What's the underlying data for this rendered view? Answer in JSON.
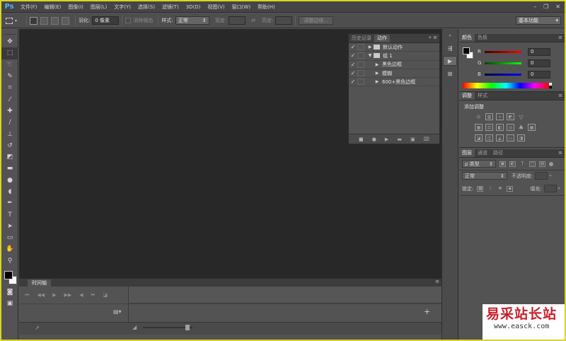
{
  "app": {
    "logo": "Ps"
  },
  "menu": [
    "文件(F)",
    "编辑(E)",
    "图像(I)",
    "图层(L)",
    "文字(Y)",
    "选择(S)",
    "滤镜(T)",
    "3D(D)",
    "视图(V)",
    "窗口(W)",
    "帮助(H)"
  ],
  "window_controls": {
    "minimize": "–",
    "restore": "❐",
    "close": "✕"
  },
  "options": {
    "feather_label": "羽化:",
    "feather_value": "0 像素",
    "antialias_label": "消除锯齿",
    "style_label": "样式:",
    "style_value": "正常",
    "width_label": "宽度:",
    "height_label": "高度:",
    "refine_edge": "调整边缘...",
    "workspace": "基本功能"
  },
  "actions_panel": {
    "tabs": [
      "历史记录",
      "动作"
    ],
    "rows": [
      {
        "label": "默认动作",
        "type": "set",
        "expanded": false
      },
      {
        "label": "组 1",
        "type": "set",
        "expanded": true
      },
      {
        "label": "黑色边框",
        "type": "action"
      },
      {
        "label": "模糊",
        "type": "action"
      },
      {
        "label": "600+黑色边框",
        "type": "action"
      }
    ]
  },
  "timeline": {
    "tab": "时间轴"
  },
  "color_panel": {
    "tabs": [
      "颜色",
      "色板"
    ],
    "sliders": [
      {
        "letter": "R",
        "value": "0",
        "color": "#d03030"
      },
      {
        "letter": "G",
        "value": "0",
        "color": "#30b030"
      },
      {
        "letter": "B",
        "value": "0",
        "color": "#3050d0"
      }
    ]
  },
  "adjustments_panel": {
    "tabs": [
      "调整",
      "样式"
    ],
    "title": "添加调整",
    "icons": [
      "brightness-icon",
      "levels-icon",
      "curves-icon",
      "exposure-icon",
      "vibrance-icon",
      "hsl-icon",
      "colorbalance-icon",
      "bw-icon",
      "photofilter-icon",
      "channelmixer-icon",
      "colorlookup-icon",
      "invert-icon",
      "posterize-icon",
      "threshold-icon",
      "gradientmap-icon",
      "selectivecolor-icon"
    ]
  },
  "layers_panel": {
    "tabs": [
      "图层",
      "通道",
      "路径"
    ],
    "filter_label": "ρ 类型",
    "blend_mode": "正常",
    "opacity_label": "不透明度:",
    "lock_label": "锁定:",
    "fill_label": "填充:"
  },
  "watermark": {
    "chinese": "易采站长站",
    "url": "www.easck.com"
  }
}
